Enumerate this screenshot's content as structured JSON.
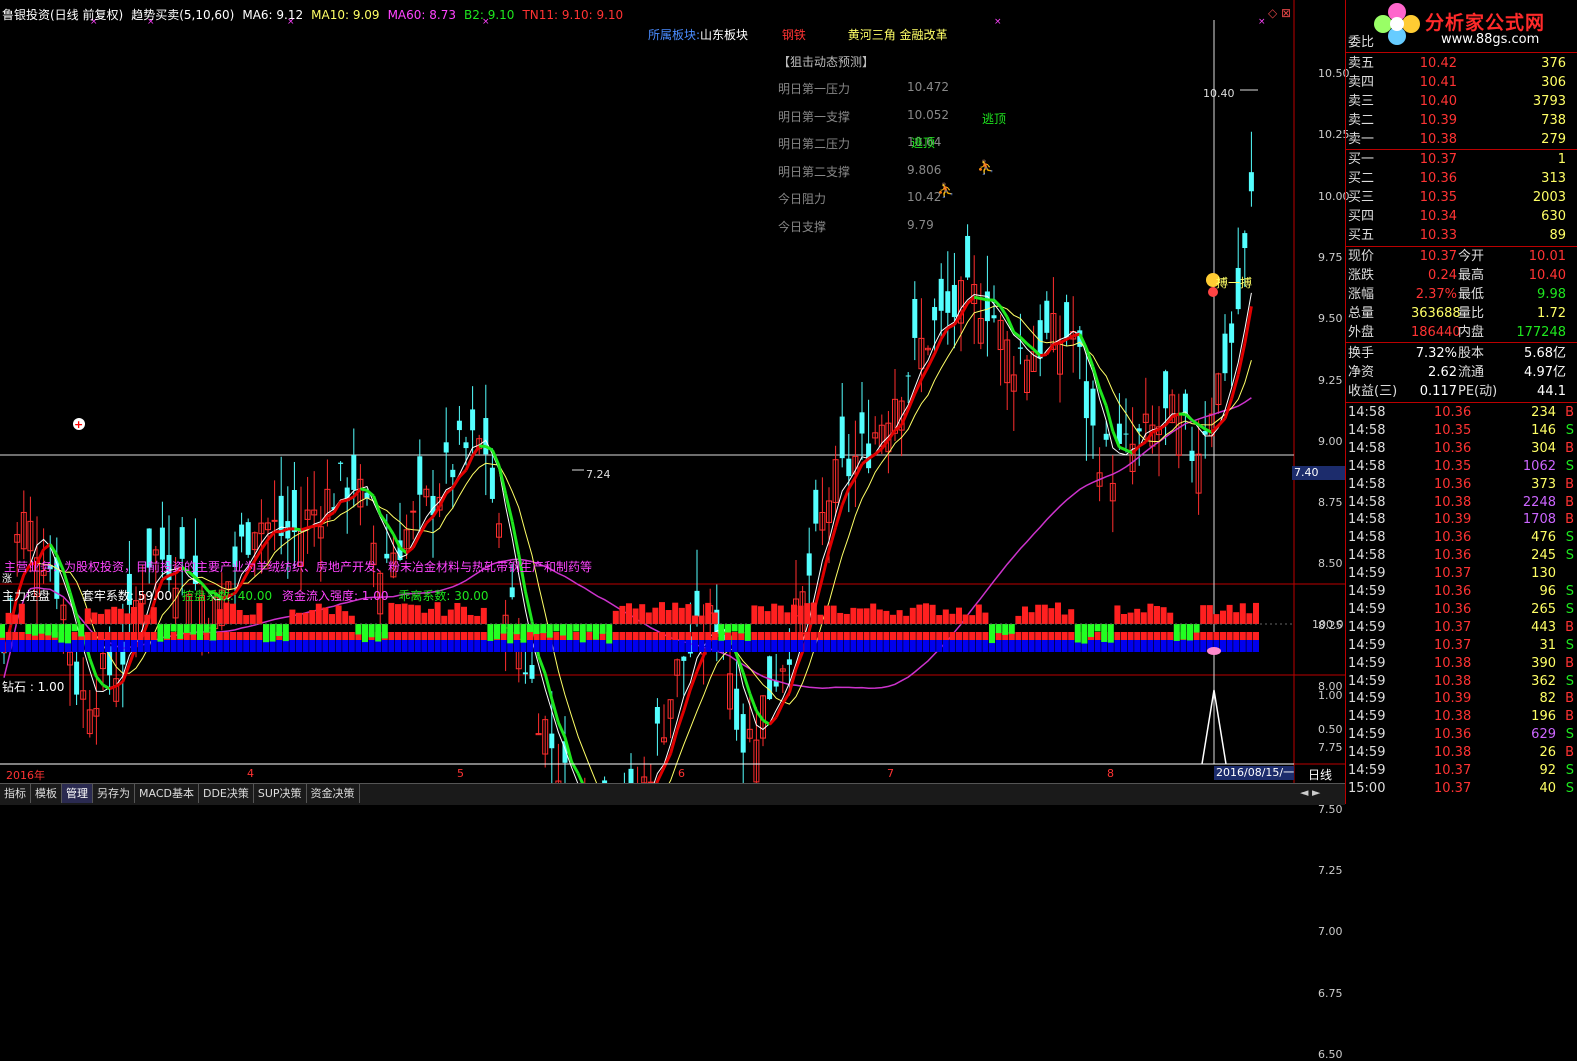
{
  "colors": {
    "up": "#ff2e2e",
    "down": "#54ffff",
    "ma_green": "#1ee61e",
    "ma_red": "#e00000",
    "ma_white": "#ffffff",
    "ma_yellow": "#ffff66",
    "ma60": "#cc33cc",
    "bg": "#000000"
  },
  "title_bar": {
    "stock": "鲁银投资(日线 前复权)",
    "indicator": "趋势买卖(5,10,60)",
    "ma6": "MA6: 9.12",
    "ma10": "MA10: 9.09",
    "ma60": "MA60: 8.73",
    "b2": "B2: 9.10",
    "tn11": "TN11: 9.10",
    "tn11_b": ": 9.10"
  },
  "sector": {
    "label": "所属板块:",
    "region": "山东板块",
    "industry": "钢铁",
    "concepts": "黄河三角 金融改革"
  },
  "forecast": {
    "title": "【狙击动态预测】",
    "items": [
      {
        "label": "明日第一压力",
        "value": "10.472"
      },
      {
        "label": "明日第一支撑",
        "value": "10.052"
      },
      {
        "label": "明日第二压力",
        "value": "10.64"
      },
      {
        "label": "明日第二支撑",
        "value": "9.806"
      },
      {
        "label": "今日阻力",
        "value": "10.42"
      },
      {
        "label": "今日支撑",
        "value": "9.79"
      }
    ]
  },
  "annotations": {
    "escape1": "逃顶",
    "escape2": "逃顶",
    "gamble": "搏一搏",
    "high_label": "10.40",
    "low_label": "7.24",
    "cursor_price": "7.40"
  },
  "price_axis": [
    "10.50",
    "10.25",
    "10.00",
    "9.75",
    "9.50",
    "9.25",
    "9.00",
    "8.75",
    "8.50",
    "8.25",
    "8.00",
    "7.75",
    "7.50",
    "7.25",
    "7.00",
    "6.75",
    "6.50"
  ],
  "main_business": "主营业务：为股权投资，目前投资的主要产业为羊绒纺织、房地产开发、粉末冶金材料与热轧带钢生产和制药等",
  "panel_marker": "涨",
  "panel2": {
    "title": "主力控盘",
    "p1": "套牢系数: 59.00",
    "p2": "控盘系数: 40.00",
    "p3": "资金流入强度: 1.00",
    "p4": "乖离系数: 30.00",
    "axis": "100.0"
  },
  "panel3": {
    "title": "钻石 : 1.00",
    "axis_top": "1.00",
    "axis_mid": "0.50"
  },
  "date_axis": [
    "2016年",
    "4",
    "5",
    "6",
    "7",
    "8"
  ],
  "cursor_date": "2016/08/15/一",
  "period": "日线",
  "tabs": [
    "指标",
    "模板",
    "管理",
    "另存为",
    "MACD基本",
    "DDE决策",
    "SUP决策",
    "资金决策"
  ],
  "logo": {
    "name": "分析家公式网",
    "url": "www.88gs.com"
  },
  "quote": {
    "weibi_label": "委比",
    "asks": [
      {
        "label": "卖五",
        "price": "10.42",
        "vol": "376"
      },
      {
        "label": "卖四",
        "price": "10.41",
        "vol": "306"
      },
      {
        "label": "卖三",
        "price": "10.40",
        "vol": "3793"
      },
      {
        "label": "卖二",
        "price": "10.39",
        "vol": "738"
      },
      {
        "label": "卖一",
        "price": "10.38",
        "vol": "279"
      }
    ],
    "bids": [
      {
        "label": "买一",
        "price": "10.37",
        "vol": "1"
      },
      {
        "label": "买二",
        "price": "10.36",
        "vol": "313"
      },
      {
        "label": "买三",
        "price": "10.35",
        "vol": "2003"
      },
      {
        "label": "买四",
        "price": "10.34",
        "vol": "630"
      },
      {
        "label": "买五",
        "price": "10.33",
        "vol": "89"
      }
    ],
    "stats1": [
      {
        "l1": "现价",
        "v1": "10.37",
        "l2": "今开",
        "v2": "10.01"
      },
      {
        "l1": "涨跌",
        "v1": "0.24",
        "l2": "最高",
        "v2": "10.40"
      },
      {
        "l1": "涨幅",
        "v1": "2.37%",
        "l2": "最低",
        "v2": "9.98"
      },
      {
        "l1": "总量",
        "v1": "363688",
        "l2": "量比",
        "v2": "1.72"
      },
      {
        "l1": "外盘",
        "v1": "186440",
        "l2": "内盘",
        "v2": "177248"
      }
    ],
    "stats2": [
      {
        "l1": "换手",
        "v1": "7.32%",
        "l2": "股本",
        "v2": "5.68亿"
      },
      {
        "l1": "净资",
        "v1": "2.62",
        "l2": "流通",
        "v2": "4.97亿"
      },
      {
        "l1": "收益(三)",
        "v1": "0.117",
        "l2": "PE(动)",
        "v2": "44.1"
      }
    ],
    "ticks": [
      {
        "t": "14:58",
        "p": "10.36",
        "v": "234",
        "bs": "B"
      },
      {
        "t": "14:58",
        "p": "10.35",
        "v": "146",
        "bs": "S"
      },
      {
        "t": "14:58",
        "p": "10.36",
        "v": "304",
        "bs": "B"
      },
      {
        "t": "14:58",
        "p": "10.35",
        "v": "1062",
        "bs": "S"
      },
      {
        "t": "14:58",
        "p": "10.36",
        "v": "373",
        "bs": "B"
      },
      {
        "t": "14:58",
        "p": "10.38",
        "v": "2248",
        "bs": "B"
      },
      {
        "t": "14:58",
        "p": "10.39",
        "v": "1708",
        "bs": "B"
      },
      {
        "t": "14:58",
        "p": "10.36",
        "v": "476",
        "bs": "S"
      },
      {
        "t": "14:58",
        "p": "10.36",
        "v": "245",
        "bs": "S"
      },
      {
        "t": "14:59",
        "p": "10.37",
        "v": "130",
        "bs": ""
      },
      {
        "t": "14:59",
        "p": "10.36",
        "v": "96",
        "bs": "S"
      },
      {
        "t": "14:59",
        "p": "10.36",
        "v": "265",
        "bs": "S"
      },
      {
        "t": "14:59",
        "p": "10.37",
        "v": "443",
        "bs": "B"
      },
      {
        "t": "14:59",
        "p": "10.37",
        "v": "31",
        "bs": "S"
      },
      {
        "t": "14:59",
        "p": "10.38",
        "v": "390",
        "bs": "B"
      },
      {
        "t": "14:59",
        "p": "10.38",
        "v": "362",
        "bs": "S"
      },
      {
        "t": "14:59",
        "p": "10.39",
        "v": "82",
        "bs": "B"
      },
      {
        "t": "14:59",
        "p": "10.38",
        "v": "196",
        "bs": "B"
      },
      {
        "t": "14:59",
        "p": "10.36",
        "v": "629",
        "bs": "S"
      },
      {
        "t": "14:59",
        "p": "10.38",
        "v": "26",
        "bs": "B"
      },
      {
        "t": "14:59",
        "p": "10.37",
        "v": "92",
        "bs": "S"
      },
      {
        "t": "15:00",
        "p": "10.37",
        "v": "40",
        "bs": "S"
      }
    ]
  }
}
